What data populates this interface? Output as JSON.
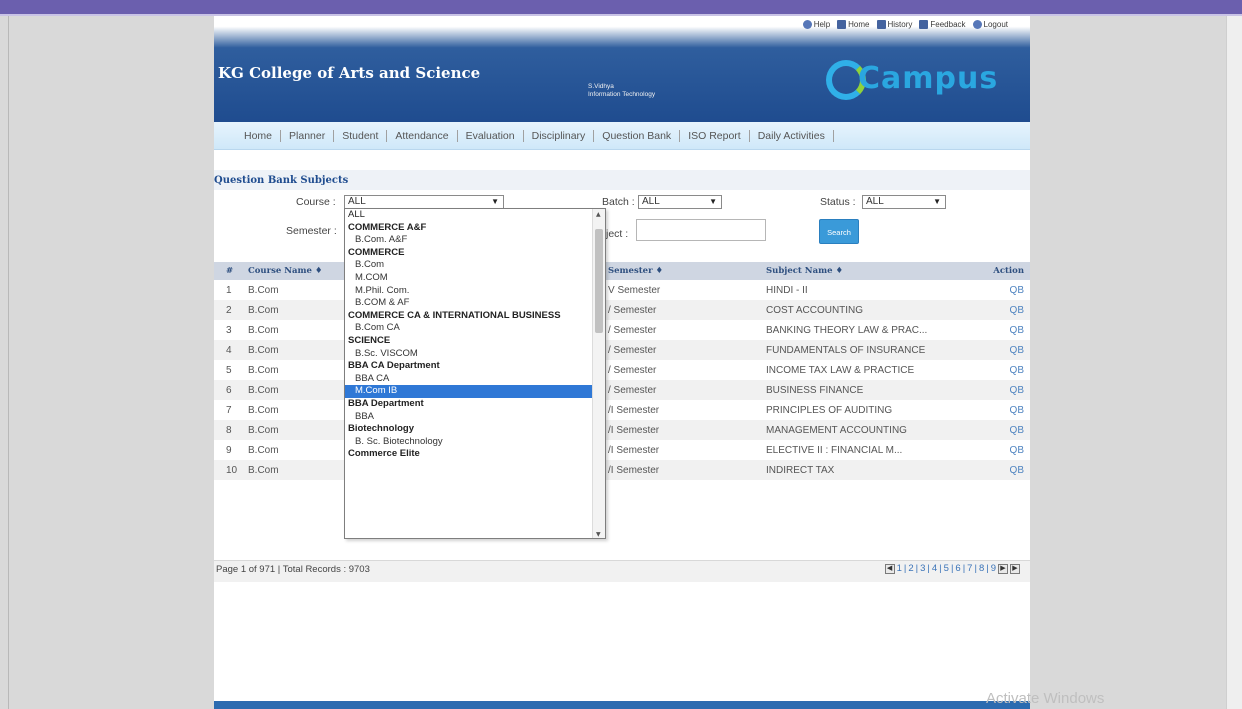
{
  "toplinks": [
    {
      "label": "Help",
      "icon": "help-icon"
    },
    {
      "label": "Home",
      "icon": "home-icon"
    },
    {
      "label": "History",
      "icon": "history-icon"
    },
    {
      "label": "Feedback",
      "icon": "feedback-icon"
    },
    {
      "label": "Logout",
      "icon": "logout-icon"
    }
  ],
  "header": {
    "college_name": "KG College of Arts and Science",
    "user_name": "S.Vidhya",
    "department": "Information Technology",
    "logo_text": "Campus",
    "logo_tagline": ""
  },
  "nav": [
    "Home",
    "Planner",
    "Student",
    "Attendance",
    "Evaluation",
    "Disciplinary",
    "Question Bank",
    "ISO Report",
    "Daily Activities"
  ],
  "section_title": "Question Bank Subjects",
  "filters": {
    "course_label": "Course :",
    "course_value": "ALL",
    "batch_label": "Batch :",
    "batch_value": "ALL",
    "status_label": "Status :",
    "status_value": "ALL",
    "semester_label": "Semester :",
    "subject_label": "ject :",
    "search_button": "Search"
  },
  "table": {
    "headers": [
      "#",
      "Course Name ♦",
      "Semester ♦",
      "Subject Name ♦",
      "Action"
    ],
    "rows": [
      {
        "num": "1",
        "course": "B.Com",
        "semester": "V Semester",
        "subject": "HINDI - II",
        "action": "QB"
      },
      {
        "num": "2",
        "course": "B.Com",
        "semester": "/ Semester",
        "subject": "COST ACCOUNTING",
        "action": "QB"
      },
      {
        "num": "3",
        "course": "B.Com",
        "semester": "/ Semester",
        "subject": "BANKING THEORY LAW & PRAC...",
        "action": "QB"
      },
      {
        "num": "4",
        "course": "B.Com",
        "semester": "/ Semester",
        "subject": "FUNDAMENTALS OF INSURANCE",
        "action": "QB"
      },
      {
        "num": "5",
        "course": "B.Com",
        "semester": "/ Semester",
        "subject": "INCOME TAX LAW & PRACTICE",
        "action": "QB"
      },
      {
        "num": "6",
        "course": "B.Com",
        "semester": "/ Semester",
        "subject": "BUSINESS FINANCE",
        "action": "QB"
      },
      {
        "num": "7",
        "course": "B.Com",
        "semester": "/I Semester",
        "subject": "PRINCIPLES OF AUDITING",
        "action": "QB"
      },
      {
        "num": "8",
        "course": "B.Com",
        "semester": "/I Semester",
        "subject": "MANAGEMENT ACCOUNTING",
        "action": "QB"
      },
      {
        "num": "9",
        "course": "B.Com",
        "semester": "/I Semester",
        "subject": "ELECTIVE II : FINANCIAL M...",
        "action": "QB"
      },
      {
        "num": "10",
        "course": "B.Com",
        "semester": "/I Semester",
        "subject": "INDIRECT TAX",
        "action": "QB"
      }
    ]
  },
  "pager": {
    "text": "Page 1 of 971 | Total Records : 9703",
    "pages": [
      "1",
      "2",
      "3",
      "4",
      "5",
      "6",
      "7",
      "8",
      "9"
    ]
  },
  "dropdown": {
    "items": [
      {
        "label": "ALL",
        "kind": "opt0"
      },
      {
        "label": "COMMERCE A&F",
        "kind": "group"
      },
      {
        "label": "B.Com. A&F",
        "kind": "opt"
      },
      {
        "label": "COMMERCE",
        "kind": "group"
      },
      {
        "label": "B.Com",
        "kind": "opt"
      },
      {
        "label": "M.COM",
        "kind": "opt"
      },
      {
        "label": "M.Phil. Com.",
        "kind": "opt"
      },
      {
        "label": "B.COM & AF",
        "kind": "opt"
      },
      {
        "label": "COMMERCE CA & INTERNATIONAL BUSINESS",
        "kind": "group"
      },
      {
        "label": "B.Com CA",
        "kind": "opt"
      },
      {
        "label": "SCIENCE",
        "kind": "group"
      },
      {
        "label": "B.Sc. VISCOM",
        "kind": "opt"
      },
      {
        "label": "BBA CA Department",
        "kind": "group"
      },
      {
        "label": "BBA CA",
        "kind": "opt"
      },
      {
        "label": "M.Com IB",
        "kind": "sel"
      },
      {
        "label": "BBA Department",
        "kind": "group"
      },
      {
        "label": "BBA",
        "kind": "opt"
      },
      {
        "label": "Biotechnology",
        "kind": "group"
      },
      {
        "label": "B. Sc. Biotechnology",
        "kind": "opt"
      },
      {
        "label": "Commerce Elite",
        "kind": "group"
      }
    ]
  },
  "watermark": "Activate Windows",
  "colors": {
    "header_blue": "#1f4c8f",
    "accent": "#2f78d6",
    "topbar": "#6b5fae"
  }
}
